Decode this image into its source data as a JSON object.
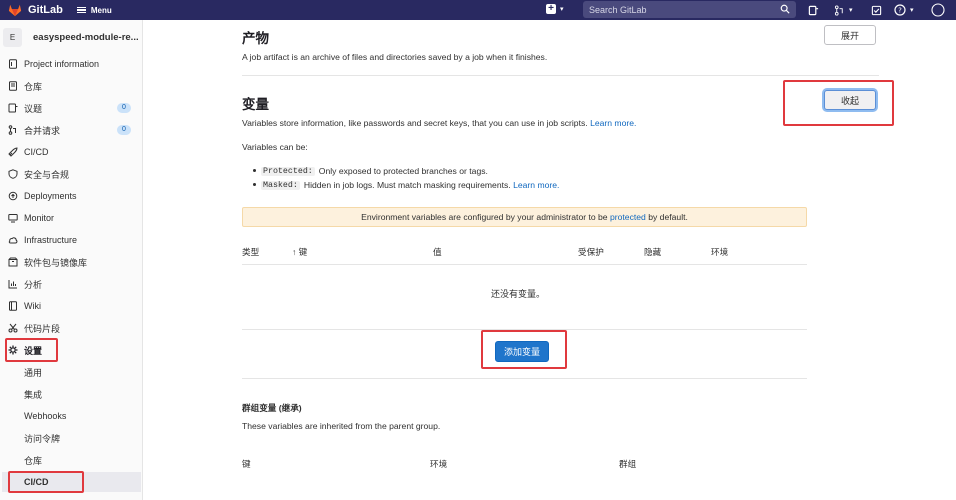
{
  "topbar": {
    "logo_text": "GitLab",
    "menu_label": "Menu",
    "search_placeholder": "Search GitLab"
  },
  "sidebar": {
    "project_avatar": "E",
    "project_name": "easyspeed-module-re...",
    "items": [
      {
        "label": "Project information",
        "icon": "info-icon"
      },
      {
        "label": "仓库",
        "icon": "repository-icon"
      },
      {
        "label": "议题",
        "icon": "issues-icon",
        "badge": "0"
      },
      {
        "label": "合并请求",
        "icon": "merge-request-icon",
        "badge": "0"
      },
      {
        "label": "CI/CD",
        "icon": "rocket-icon"
      },
      {
        "label": "安全与合规",
        "icon": "shield-icon"
      },
      {
        "label": "Deployments",
        "icon": "deployments-icon"
      },
      {
        "label": "Monitor",
        "icon": "monitor-icon"
      },
      {
        "label": "Infrastructure",
        "icon": "cloud-icon"
      },
      {
        "label": "软件包与镜像库",
        "icon": "package-icon"
      },
      {
        "label": "分析",
        "icon": "chart-icon"
      },
      {
        "label": "Wiki",
        "icon": "book-icon"
      },
      {
        "label": "代码片段",
        "icon": "snippet-icon"
      },
      {
        "label": "设置",
        "icon": "gear-icon"
      }
    ],
    "sub_items": [
      "通用",
      "集成",
      "Webhooks",
      "访问令牌",
      "仓库",
      "CI/CD"
    ]
  },
  "artifacts": {
    "title": "产物",
    "description": "A job artifact is an archive of files and directories saved by a job when it finishes.",
    "expand_label": "展开"
  },
  "variables": {
    "title": "变量",
    "description": "Variables store information, like passwords and secret keys, that you can use in job scripts.",
    "learn_more": "Learn more.",
    "collapse_label": "收起",
    "can_be": "Variables can be:",
    "bullets": [
      {
        "code": "Protected:",
        "text": "Only exposed to protected branches or tags.",
        "link": ""
      },
      {
        "code": "Masked:",
        "text": "Hidden in job logs. Must match masking requirements.",
        "link": "Learn more."
      }
    ],
    "alert_pre": "Environment variables are configured by your administrator to be",
    "alert_link": "protected",
    "alert_post": "by default.",
    "columns": {
      "type": "类型",
      "key": "↑ 键",
      "value": "值",
      "protected": "受保护",
      "masked": "隐藏",
      "environment": "环境"
    },
    "empty_text": "还没有变量。",
    "add_label": "添加变量"
  },
  "group_variables": {
    "title": "群组变量 (继承)",
    "description": "These variables are inherited from the parent group.",
    "columns": {
      "key": "键",
      "environment": "环境",
      "group": "群组"
    }
  },
  "colors": {
    "navbar": "#292961",
    "primary": "#1f75cb",
    "annotation_red": "#e0393e",
    "alert_bg": "#fdf1dd"
  }
}
